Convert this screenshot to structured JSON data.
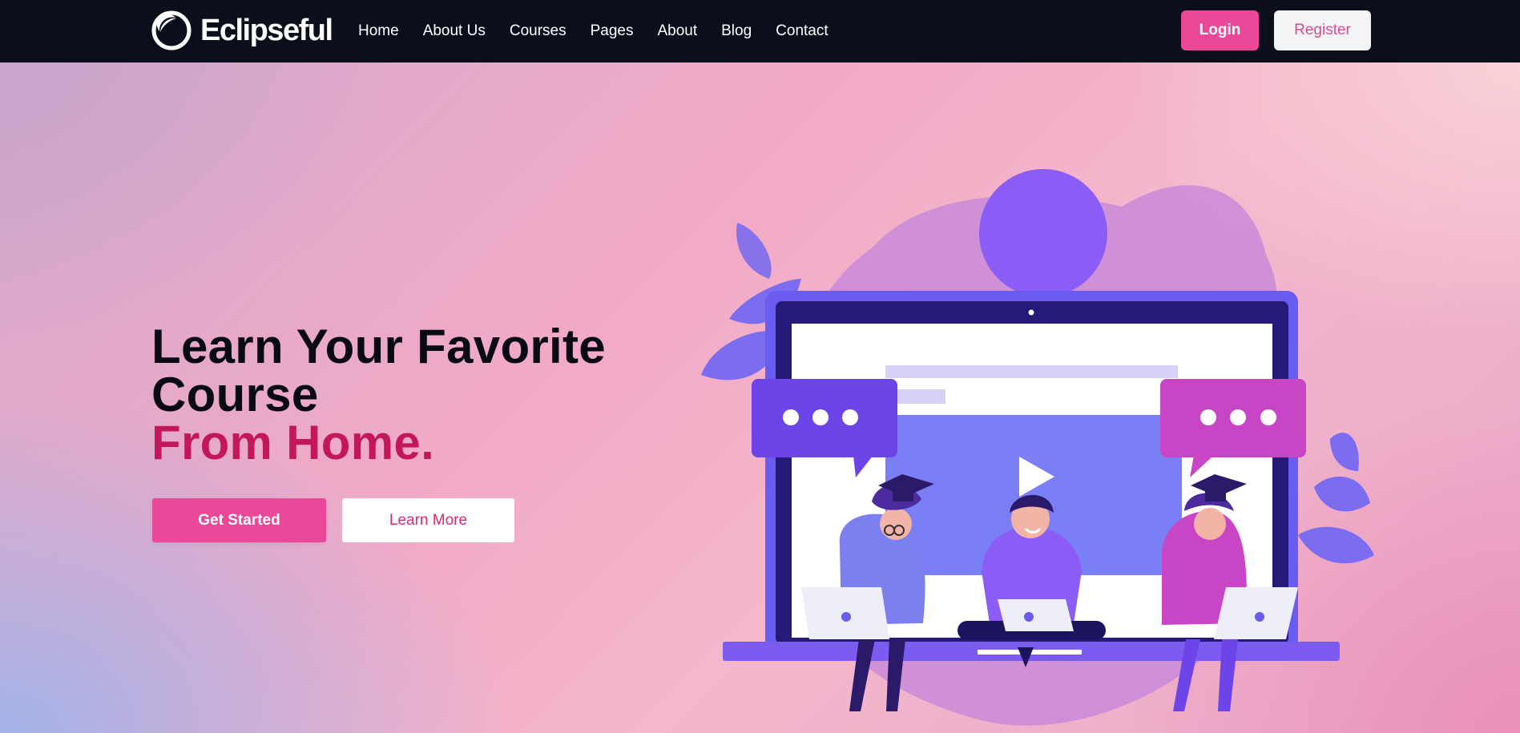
{
  "brand": {
    "name": "Eclipseful",
    "icon": "eclipse-logo-icon"
  },
  "nav": {
    "links": [
      "Home",
      "About Us",
      "Courses",
      "Pages",
      "About",
      "Blog",
      "Contact"
    ],
    "login_label": "Login",
    "register_label": "Register"
  },
  "hero": {
    "headline_line1": "Learn Your Favorite",
    "headline_line2": "Course",
    "headline_accent": "From Home.",
    "primary_cta": "Get Started",
    "secondary_cta": "Learn More",
    "illustration": "students-online-learning-illustration"
  },
  "colors": {
    "nav_bg": "#0b0f1c",
    "accent_pink": "#ec4899",
    "headline_accent": "#c2185b",
    "illustration_purple": "#7b61ff",
    "illustration_magenta": "#c84fc8"
  }
}
